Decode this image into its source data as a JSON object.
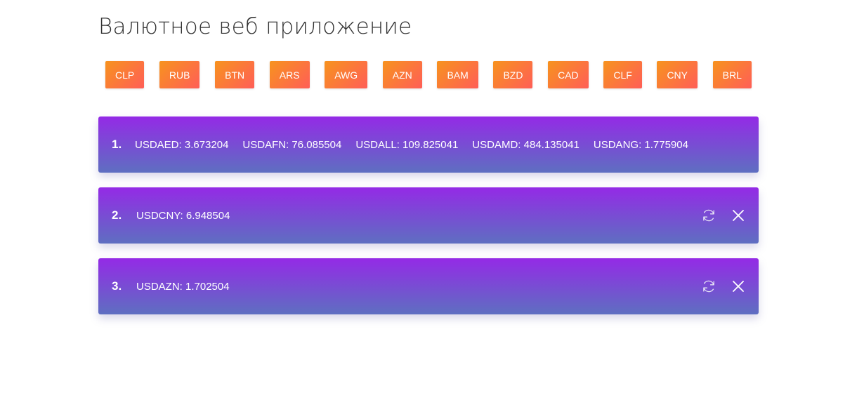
{
  "app": {
    "title": "Валютное веб приложение"
  },
  "currencies": [
    "CLP",
    "RUB",
    "BTN",
    "ARS",
    "AWG",
    "AZN",
    "BAM",
    "BZD",
    "CAD",
    "CLF",
    "CNY",
    "BRL"
  ],
  "cards": [
    {
      "number": "1.",
      "rates": [
        "USDAED: 3.673204",
        "USDAFN: 76.085504",
        "USDALL: 109.825041",
        "USDAMD: 484.135041",
        "USDANG: 1.775904"
      ],
      "has_actions": false
    },
    {
      "number": "2.",
      "rates": [
        "USDCNY: 6.948504"
      ],
      "has_actions": true
    },
    {
      "number": "3.",
      "rates": [
        "USDAZN: 1.702504"
      ],
      "has_actions": true
    }
  ],
  "icons": {
    "refresh": "refresh-icon",
    "close": "close-icon"
  },
  "colors": {
    "button_gradient_start": "#f7931e",
    "button_gradient_end": "#ff5e57",
    "card_gradient_top": "#942ae6",
    "card_gradient_bottom": "#5e6fc1"
  }
}
